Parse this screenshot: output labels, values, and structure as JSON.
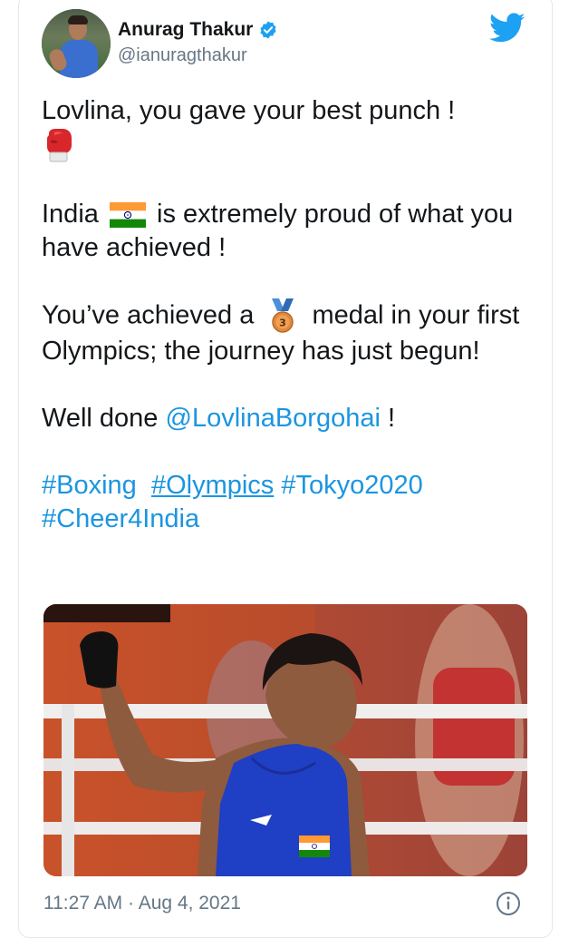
{
  "author": {
    "name": "Anurag Thakur",
    "handle": "@ianuragthakur",
    "verified": true,
    "avatar_icon": "profile-photo"
  },
  "tweet": {
    "line1": "Lovlina, you gave your best punch !",
    "line1_emoji": "boxing-glove-icon",
    "para2_part1": "India",
    "para2_emoji": "india-flag-icon",
    "para2_part2": "is extremely proud of what you have achieved !",
    "para3_part1": "You’ve achieved a",
    "para3_emoji": "3rd-place-medal-icon",
    "para3_part2": "medal in your first Olympics; the journey has just begun!",
    "para4_part1": "Well done",
    "para4_mention": "@LovlinaBorgohai",
    "para4_part2": " !",
    "hashtags": [
      "#Boxing",
      "#Olympics",
      "#Tokyo2020",
      "#Cheer4India"
    ]
  },
  "footer": {
    "time": "11:27 AM",
    "separator": "·",
    "date": "Aug 4, 2021"
  },
  "colors": {
    "link": "#1b95e0",
    "text": "#14171a",
    "muted": "#657786",
    "twitter_blue": "#1da1f2"
  }
}
